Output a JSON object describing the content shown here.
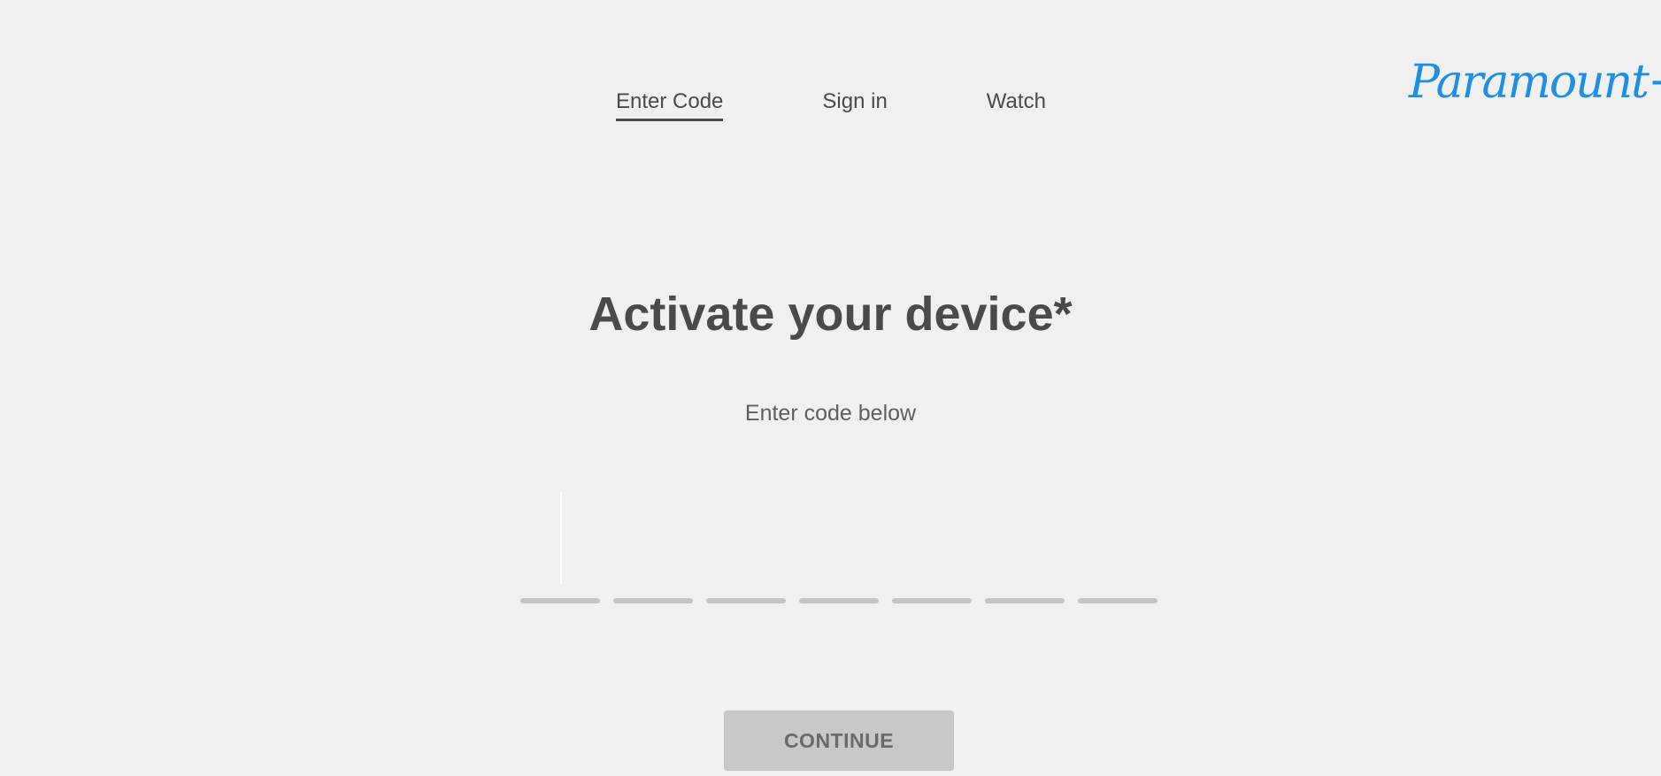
{
  "nav": {
    "steps": [
      {
        "label": "Enter Code",
        "active": true
      },
      {
        "label": "Sign in",
        "active": false
      },
      {
        "label": "Watch",
        "active": false
      }
    ]
  },
  "logo": {
    "text": "Paramount+",
    "color": "#1f8fe6"
  },
  "main": {
    "title": "Activate your device*",
    "subtitle": "Enter code below",
    "code_digits": [
      "",
      "",
      "",
      "",
      "",
      "",
      ""
    ],
    "continue_label": "CONTINUE"
  },
  "colors": {
    "background": "#f0f0f0",
    "text_dark": "#4a4a4a",
    "underline": "#c4c4c4",
    "button_bg": "#c8c8c8"
  }
}
